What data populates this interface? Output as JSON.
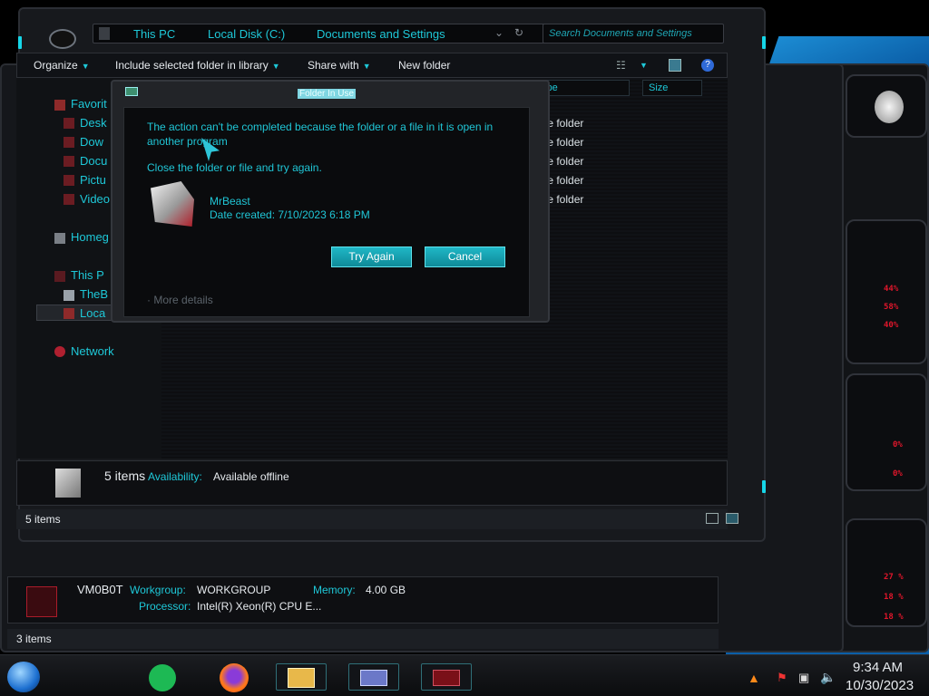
{
  "explorer": {
    "breadcrumb": [
      "This PC",
      "Local Disk (C:)",
      "Documents and Settings"
    ],
    "search_placeholder": "Search Documents and Settings",
    "toolbar": {
      "organize": "Organize",
      "include_library": "Include selected folder in library",
      "share_with": "Share with",
      "new_folder": "New folder"
    },
    "nav": {
      "favorites": "Favorit",
      "desktop": "Desk",
      "downloads": "Dow",
      "documents": "Docu",
      "pictures": "Pictu",
      "videos": "Video",
      "homegroup": "Homeg",
      "this_pc": "This P",
      "thebest": "TheB",
      "local": "Loca",
      "network": "Network"
    },
    "columns": {
      "type": "ype",
      "size": "Size"
    },
    "rows": [
      "ile folder",
      "ile folder",
      "ile folder",
      "ile folder",
      "ile folder"
    ],
    "details": {
      "count": "5 items",
      "availability_label": "Availability:",
      "availability_value": "Available offline"
    },
    "status": "5 items"
  },
  "dialog": {
    "title": "Folder In Use",
    "message": "The action can't be completed because the folder or a file in it is open in another program",
    "hint": "Close the folder or file and try again.",
    "item_name": "MrBeast",
    "item_date": "Date created: 7/10/2023 6:18 PM",
    "try_again": "Try Again",
    "cancel": "Cancel",
    "more_details": "More details"
  },
  "pc_window": {
    "name": "VM0B0T",
    "workgroup_label": "Workgroup:",
    "workgroup_value": "WORKGROUP",
    "memory_label": "Memory:",
    "memory_value": "4.00 GB",
    "processor_label": "Processor:",
    "processor_value": "Intel(R) Xeon(R) CPU E...",
    "status": "3 items"
  },
  "gadget": {
    "readouts": [
      "44%",
      "58%",
      "40%",
      "0%",
      "0%",
      "27 %",
      "18 %",
      "18 %"
    ]
  },
  "taskbar": {
    "time": "9:34 AM",
    "date": "10/30/2023"
  },
  "colors": {
    "accent": "#1ec8d8",
    "alert": "#e0162b"
  }
}
